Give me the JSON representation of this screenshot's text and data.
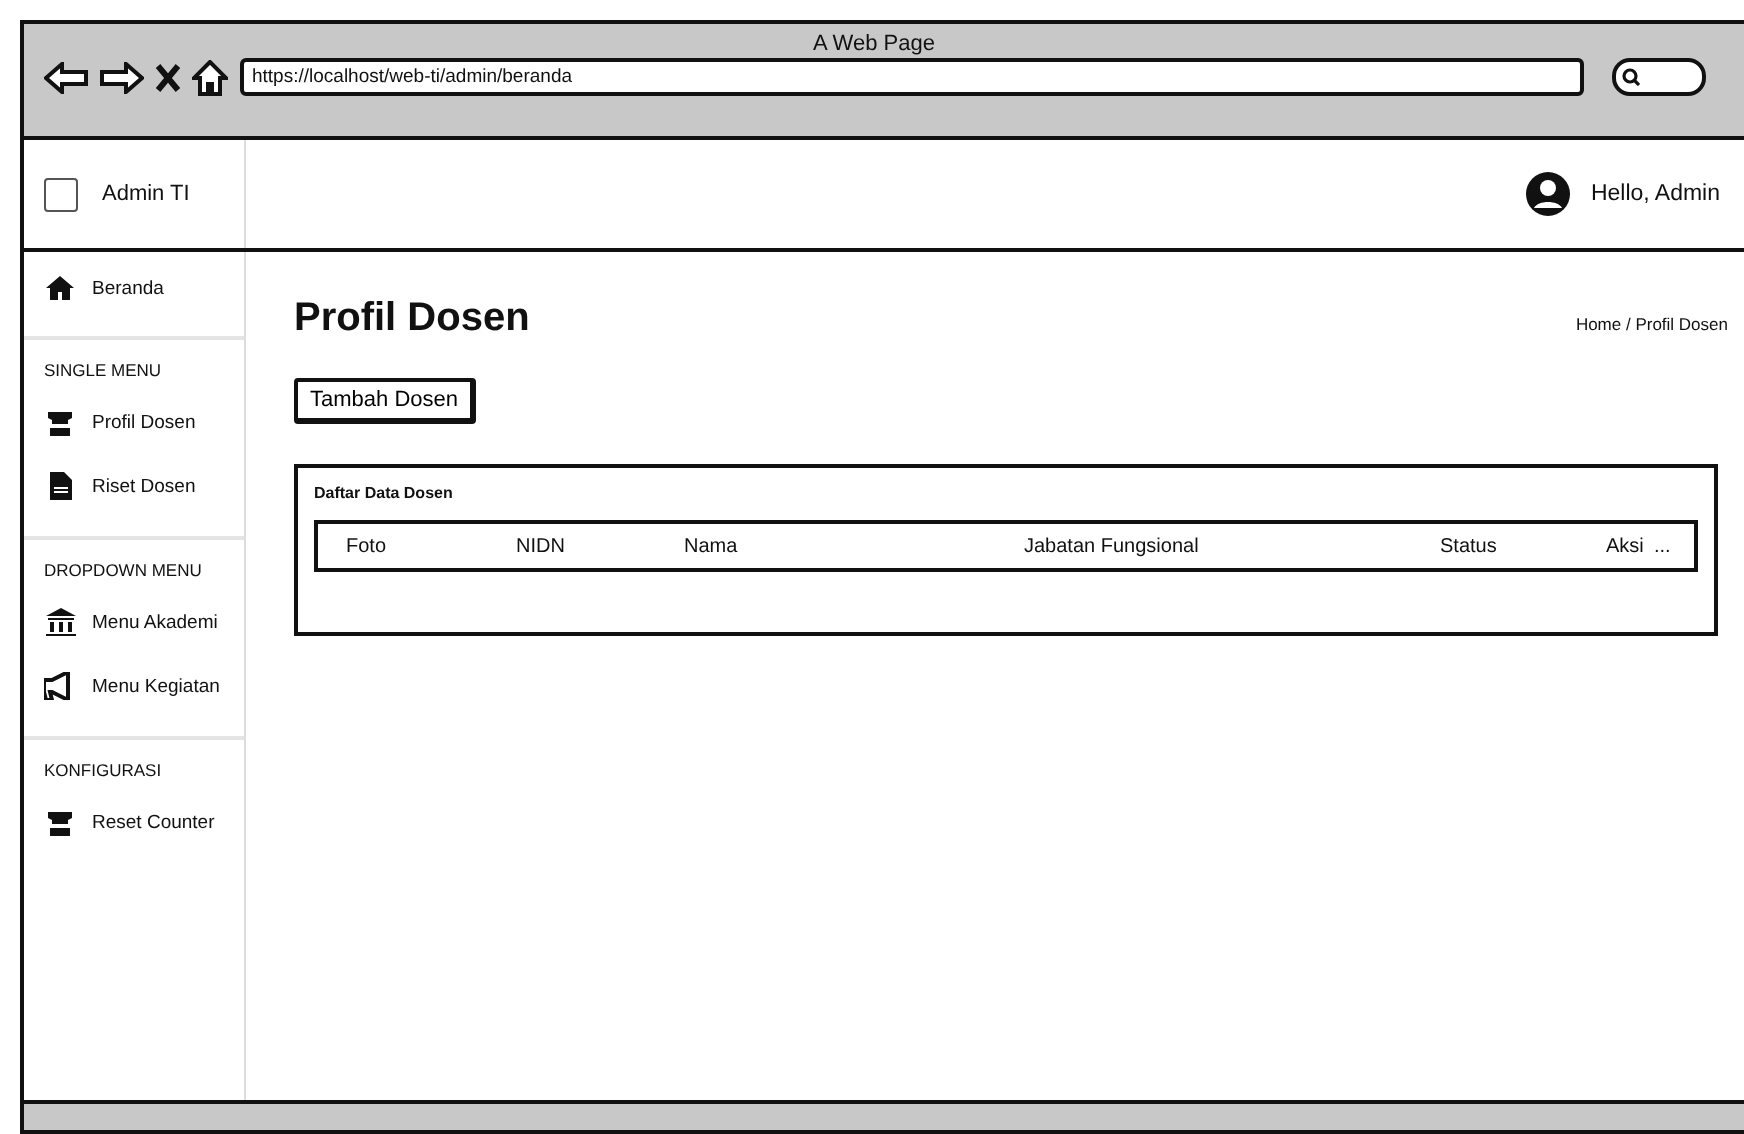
{
  "window": {
    "title": "A Web Page",
    "url": "https://localhost/web-ti/admin/beranda"
  },
  "header": {
    "checked": false,
    "brand": "Admin TI",
    "greeting": "Hello, Admin"
  },
  "sidebar": {
    "sections": [
      {
        "items": [
          "Beranda"
        ]
      },
      {
        "heading": "SINGLE MENU",
        "items": [
          "Profil Dosen",
          "Riset Dosen"
        ]
      },
      {
        "heading": "DROPDOWN MENU",
        "items": [
          "Menu Akademi",
          "Menu Kegiatan"
        ]
      },
      {
        "heading": "KONFIGURASI",
        "items": [
          "Reset Counter"
        ]
      }
    ]
  },
  "page": {
    "title": "Profil Dosen",
    "breadcrumb": "Home / Profil Dosen",
    "add_button": "Tambah Dosen"
  },
  "card": {
    "title": "Daftar Data Dosen",
    "table": {
      "columns": [
        "Foto",
        "NIDN",
        "Nama",
        "Jabatan Fungsional",
        "Status",
        "Aksi",
        "..."
      ]
    }
  }
}
